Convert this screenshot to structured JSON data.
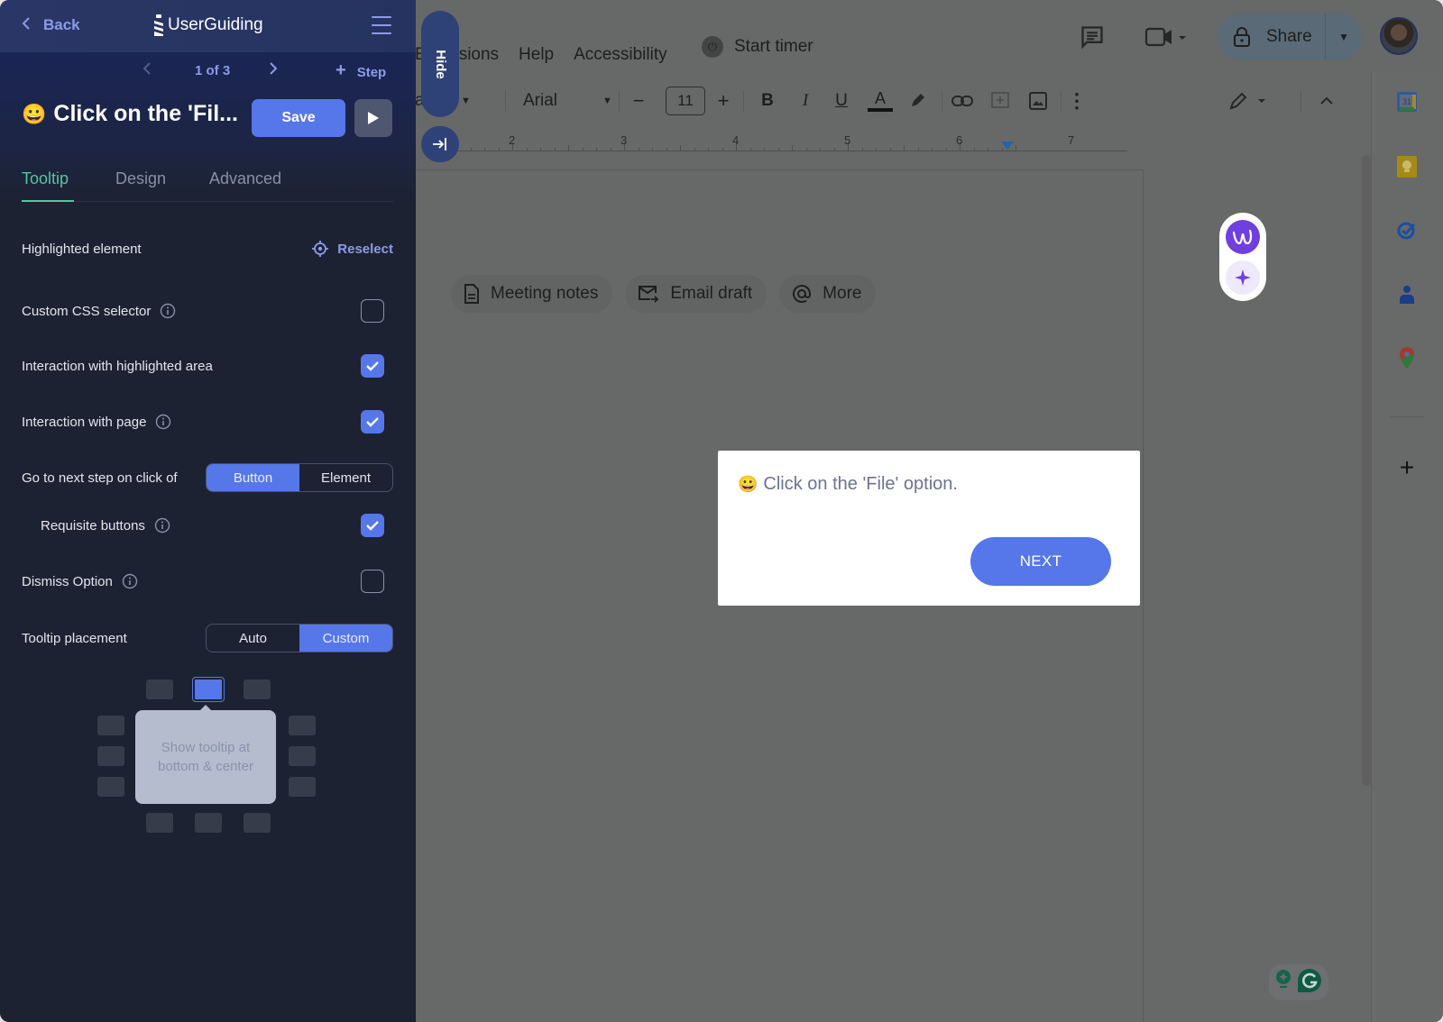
{
  "panel": {
    "back_label": "Back",
    "brand": "UserGuiding",
    "step_nav": {
      "counter": "1 of 3",
      "add_step_label": "Step"
    },
    "step_title": {
      "emoji": "😀",
      "text": "Click on the 'Fil..."
    },
    "save_label": "Save",
    "tabs": [
      {
        "label": "Tooltip",
        "active": true
      },
      {
        "label": "Design",
        "active": false
      },
      {
        "label": "Advanced",
        "active": false
      }
    ],
    "settings": {
      "highlighted_element": {
        "label": "Highlighted element",
        "action": "Reselect"
      },
      "custom_css_selector": {
        "label": "Custom CSS selector",
        "checked": false
      },
      "interaction_highlighted": {
        "label": "Interaction with highlighted area",
        "checked": true
      },
      "interaction_page": {
        "label": "Interaction with page",
        "checked": true
      },
      "next_step_on": {
        "label": "Go to next step on click of",
        "options": [
          "Button",
          "Element"
        ],
        "selected": "Button"
      },
      "requisite_buttons": {
        "label": "Requisite buttons",
        "checked": true
      },
      "dismiss_option": {
        "label": "Dismiss Option",
        "checked": false
      },
      "tooltip_placement": {
        "label": "Tooltip placement",
        "options": [
          "Auto",
          "Custom"
        ],
        "selected": "Custom"
      }
    },
    "placement_preview": {
      "text": "Show tooltip at bottom & center",
      "selected_position": "top-center"
    }
  },
  "hide_tab_label": "Hide",
  "docs": {
    "menu": [
      "E",
      "sions",
      "Help",
      "Accessibility"
    ],
    "timer_label": "Start timer",
    "share_label": "Share",
    "toolbar": {
      "style_fragment": "a    t",
      "font": "Arial",
      "font_size": "11"
    },
    "ruler_numbers": [
      "2",
      "3",
      "4",
      "5",
      "6",
      "7"
    ],
    "chips": [
      {
        "icon": "document-icon",
        "label": "Meeting notes"
      },
      {
        "icon": "email-icon",
        "label": "Email draft"
      },
      {
        "icon": "at-icon",
        "label": "More"
      }
    ],
    "calendar_day": "31"
  },
  "tooltip_preview": {
    "emoji": "😀",
    "text": "Click on the 'File' option.",
    "button_label": "NEXT"
  },
  "colors": {
    "accent": "#5577ea",
    "tab_active": "#55c6a0",
    "panel_bg": "#1d2232",
    "overlay_bg": "#676868"
  }
}
